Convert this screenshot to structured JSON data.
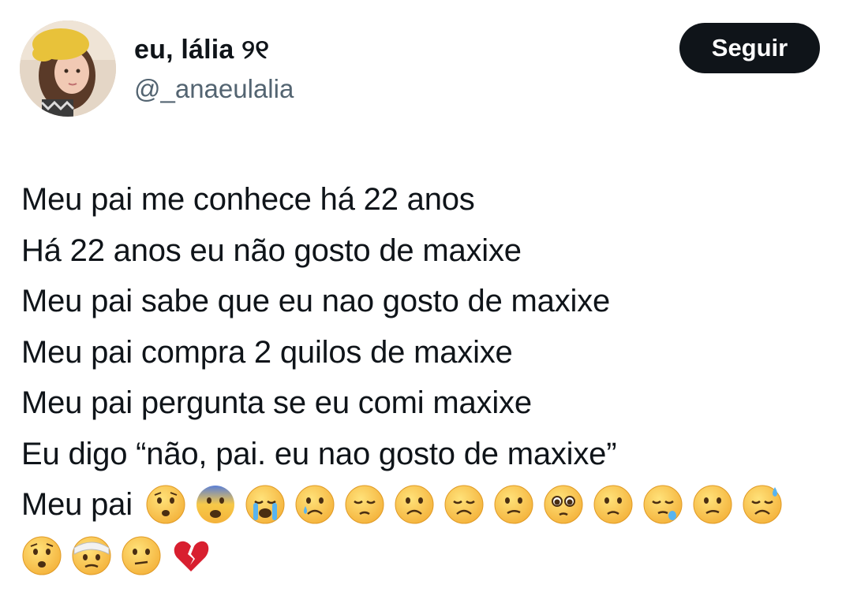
{
  "author": {
    "display_name": "eu, lália ୨୧",
    "handle": "@_anaeulalia"
  },
  "follow_button_label": "Seguir",
  "tweet": {
    "lines": [
      "Meu pai me conhece há 22 anos",
      "Há 22 anos eu não gosto de maxixe",
      "Meu pai sabe que eu nao gosto de maxixe",
      "Meu pai compra 2 quilos de maxixe",
      "Meu pai pergunta se eu comi maxixe",
      "Eu digo “não, pai. eu nao gosto de maxixe”"
    ],
    "last_line_text": "Meu pai",
    "emojis_row1": [
      "worried-face-icon",
      "fearful-face-icon",
      "loudly-crying-face-icon",
      "crying-face-icon",
      "pensive-face-icon",
      "frowning-face-icon",
      "disappointed-face-icon",
      "confused-face-icon",
      "pleading-face-icon",
      "slightly-frowning-face-icon",
      "sleepy-face-icon",
      "confused-face-icon",
      "downcast-face-with-sweat-icon"
    ],
    "emojis_row2": [
      "worried-face-icon",
      "face-with-head-bandage-icon",
      "face-with-diagonal-mouth-icon",
      "broken-heart-icon"
    ]
  }
}
